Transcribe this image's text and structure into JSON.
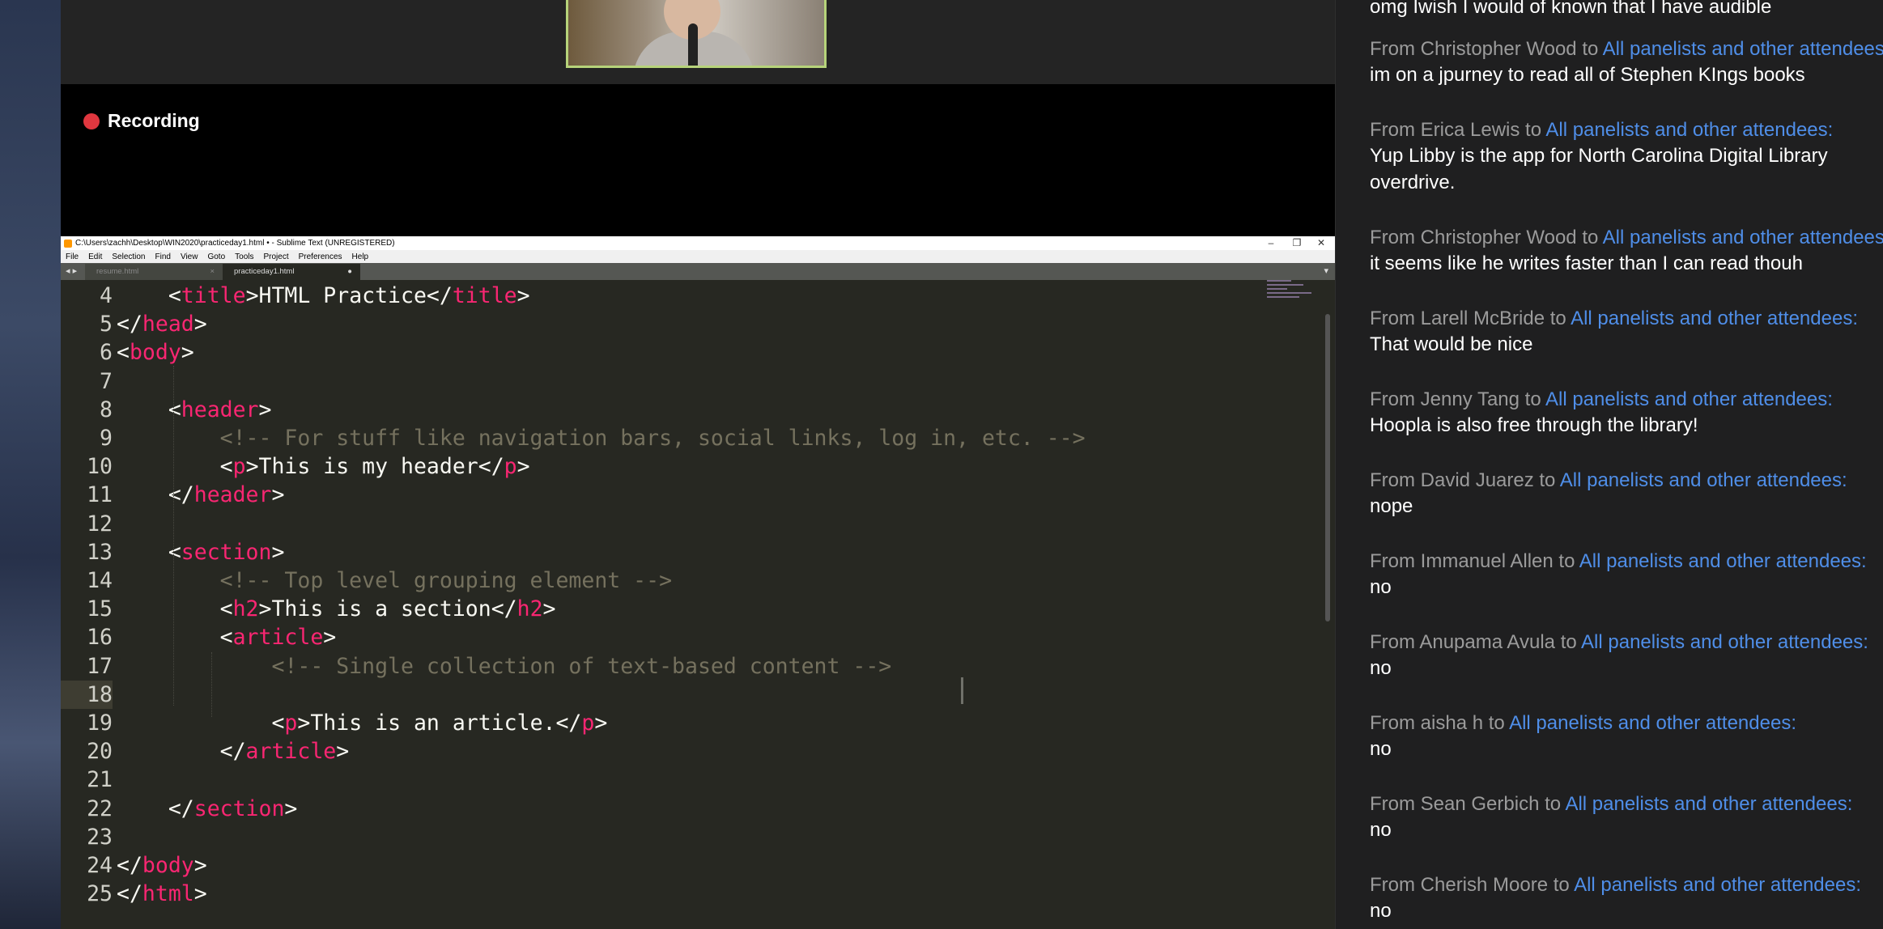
{
  "zoom": {
    "recording_label": "Recording"
  },
  "sublime": {
    "title": "C:\\Users\\zachh\\Desktop\\WIN2020\\practiceday1.html • - Sublime Text (UNREGISTERED)",
    "window_controls": [
      "–",
      "❐",
      "✕"
    ],
    "menu": [
      "File",
      "Edit",
      "Selection",
      "Find",
      "View",
      "Goto",
      "Tools",
      "Project",
      "Preferences",
      "Help"
    ],
    "tabs": [
      {
        "label": "resume.html",
        "close": "×"
      },
      {
        "label": "practiceday1.html",
        "close": "●"
      }
    ],
    "nav_arrows": "◂ ▸",
    "tab_dropdown": "▾",
    "current_line": "18"
  },
  "code_lines": [
    {
      "n": "4",
      "segs": [
        [
          "",
          "    <"
        ],
        [
          "tag",
          "title"
        ],
        [
          "",
          ">HTML Practice</"
        ],
        [
          "tag",
          "title"
        ],
        [
          "",
          ">"
        ]
      ]
    },
    {
      "n": "5",
      "segs": [
        [
          "",
          "</"
        ],
        [
          "tag",
          "head"
        ],
        [
          "",
          ">"
        ]
      ]
    },
    {
      "n": "6",
      "segs": [
        [
          "",
          "<"
        ],
        [
          "tag",
          "body"
        ],
        [
          "",
          ">"
        ]
      ]
    },
    {
      "n": "7",
      "segs": []
    },
    {
      "n": "8",
      "segs": [
        [
          "",
          "    <"
        ],
        [
          "tag",
          "header"
        ],
        [
          "",
          ">"
        ]
      ]
    },
    {
      "n": "9",
      "segs": [
        [
          "",
          "        "
        ],
        [
          "cmt",
          "<!-- For stuff like navigation bars, social links, log in, etc. -->"
        ]
      ]
    },
    {
      "n": "10",
      "segs": [
        [
          "",
          "        <"
        ],
        [
          "tag",
          "p"
        ],
        [
          "",
          ">This is my header</"
        ],
        [
          "tag",
          "p"
        ],
        [
          "",
          ">"
        ]
      ]
    },
    {
      "n": "11",
      "segs": [
        [
          "",
          "    </"
        ],
        [
          "tag",
          "header"
        ],
        [
          "",
          ">"
        ]
      ]
    },
    {
      "n": "12",
      "segs": []
    },
    {
      "n": "13",
      "segs": [
        [
          "",
          "    <"
        ],
        [
          "tag",
          "section"
        ],
        [
          "",
          ">"
        ]
      ]
    },
    {
      "n": "14",
      "segs": [
        [
          "",
          "        "
        ],
        [
          "cmt",
          "<!-- Top level grouping element -->"
        ]
      ]
    },
    {
      "n": "15",
      "segs": [
        [
          "",
          "        <"
        ],
        [
          "tag",
          "h2"
        ],
        [
          "",
          ">This is a section</"
        ],
        [
          "tag",
          "h2"
        ],
        [
          "",
          ">"
        ]
      ]
    },
    {
      "n": "16",
      "segs": [
        [
          "",
          "        <"
        ],
        [
          "tag",
          "article"
        ],
        [
          "",
          ">"
        ]
      ]
    },
    {
      "n": "17",
      "segs": [
        [
          "",
          "            "
        ],
        [
          "cmt",
          "<!-- Single collection of text-based content -->"
        ]
      ]
    },
    {
      "n": "18",
      "segs": []
    },
    {
      "n": "19",
      "segs": [
        [
          "",
          "            <"
        ],
        [
          "tag",
          "p"
        ],
        [
          "",
          ">This is an article.</"
        ],
        [
          "tag",
          "p"
        ],
        [
          "",
          ">"
        ]
      ]
    },
    {
      "n": "20",
      "segs": [
        [
          "",
          "        </"
        ],
        [
          "tag",
          "article"
        ],
        [
          "",
          ">"
        ]
      ]
    },
    {
      "n": "21",
      "segs": []
    },
    {
      "n": "22",
      "segs": [
        [
          "",
          "    </"
        ],
        [
          "tag",
          "section"
        ],
        [
          "",
          ">"
        ]
      ]
    },
    {
      "n": "23",
      "segs": []
    },
    {
      "n": "24",
      "segs": [
        [
          "",
          "</"
        ],
        [
          "tag",
          "body"
        ],
        [
          "",
          ">"
        ]
      ]
    },
    {
      "n": "25",
      "segs": [
        [
          "",
          "</"
        ],
        [
          "tag",
          "html"
        ],
        [
          "",
          ">"
        ]
      ]
    }
  ],
  "chat": {
    "top_partial": "omg Iwish I would of known that I have audible",
    "messages": [
      {
        "from": "From Christopher Wood to ",
        "to": "All panelists and other attendees:",
        "body": "im on a jpurney to read all of Stephen KIngs books"
      },
      {
        "from": "From Erica Lewis to ",
        "to": "All panelists and other attendees:",
        "body": "Yup Libby is the app for North Carolina Digital Library overdrive."
      },
      {
        "from": "From Christopher Wood to ",
        "to": "All panelists and other attendees:",
        "body": "it seems like he writes faster than I can read thouh"
      },
      {
        "from": "From Larell McBride to ",
        "to": "All panelists and other attendees:",
        "body": "That would be nice"
      },
      {
        "from": "From Jenny Tang to ",
        "to": "All panelists and other attendees:",
        "body": "Hoopla is also free through the library!"
      },
      {
        "from": "From David Juarez to ",
        "to": "All panelists and other attendees:",
        "body": "nope"
      },
      {
        "from": "From Immanuel Allen to ",
        "to": "All panelists and other attendees:",
        "body": "no"
      },
      {
        "from": "From Anupama Avula to ",
        "to": "All panelists and other attendees:",
        "body": "no"
      },
      {
        "from": "From aisha h to ",
        "to": "All panelists and other attendees:",
        "body": "no"
      },
      {
        "from": "From Sean Gerbich to ",
        "to": "All panelists and other attendees:",
        "body": "no"
      },
      {
        "from": "From Cherish Moore to ",
        "to": "All panelists and other attendees:",
        "body": "no"
      }
    ]
  }
}
